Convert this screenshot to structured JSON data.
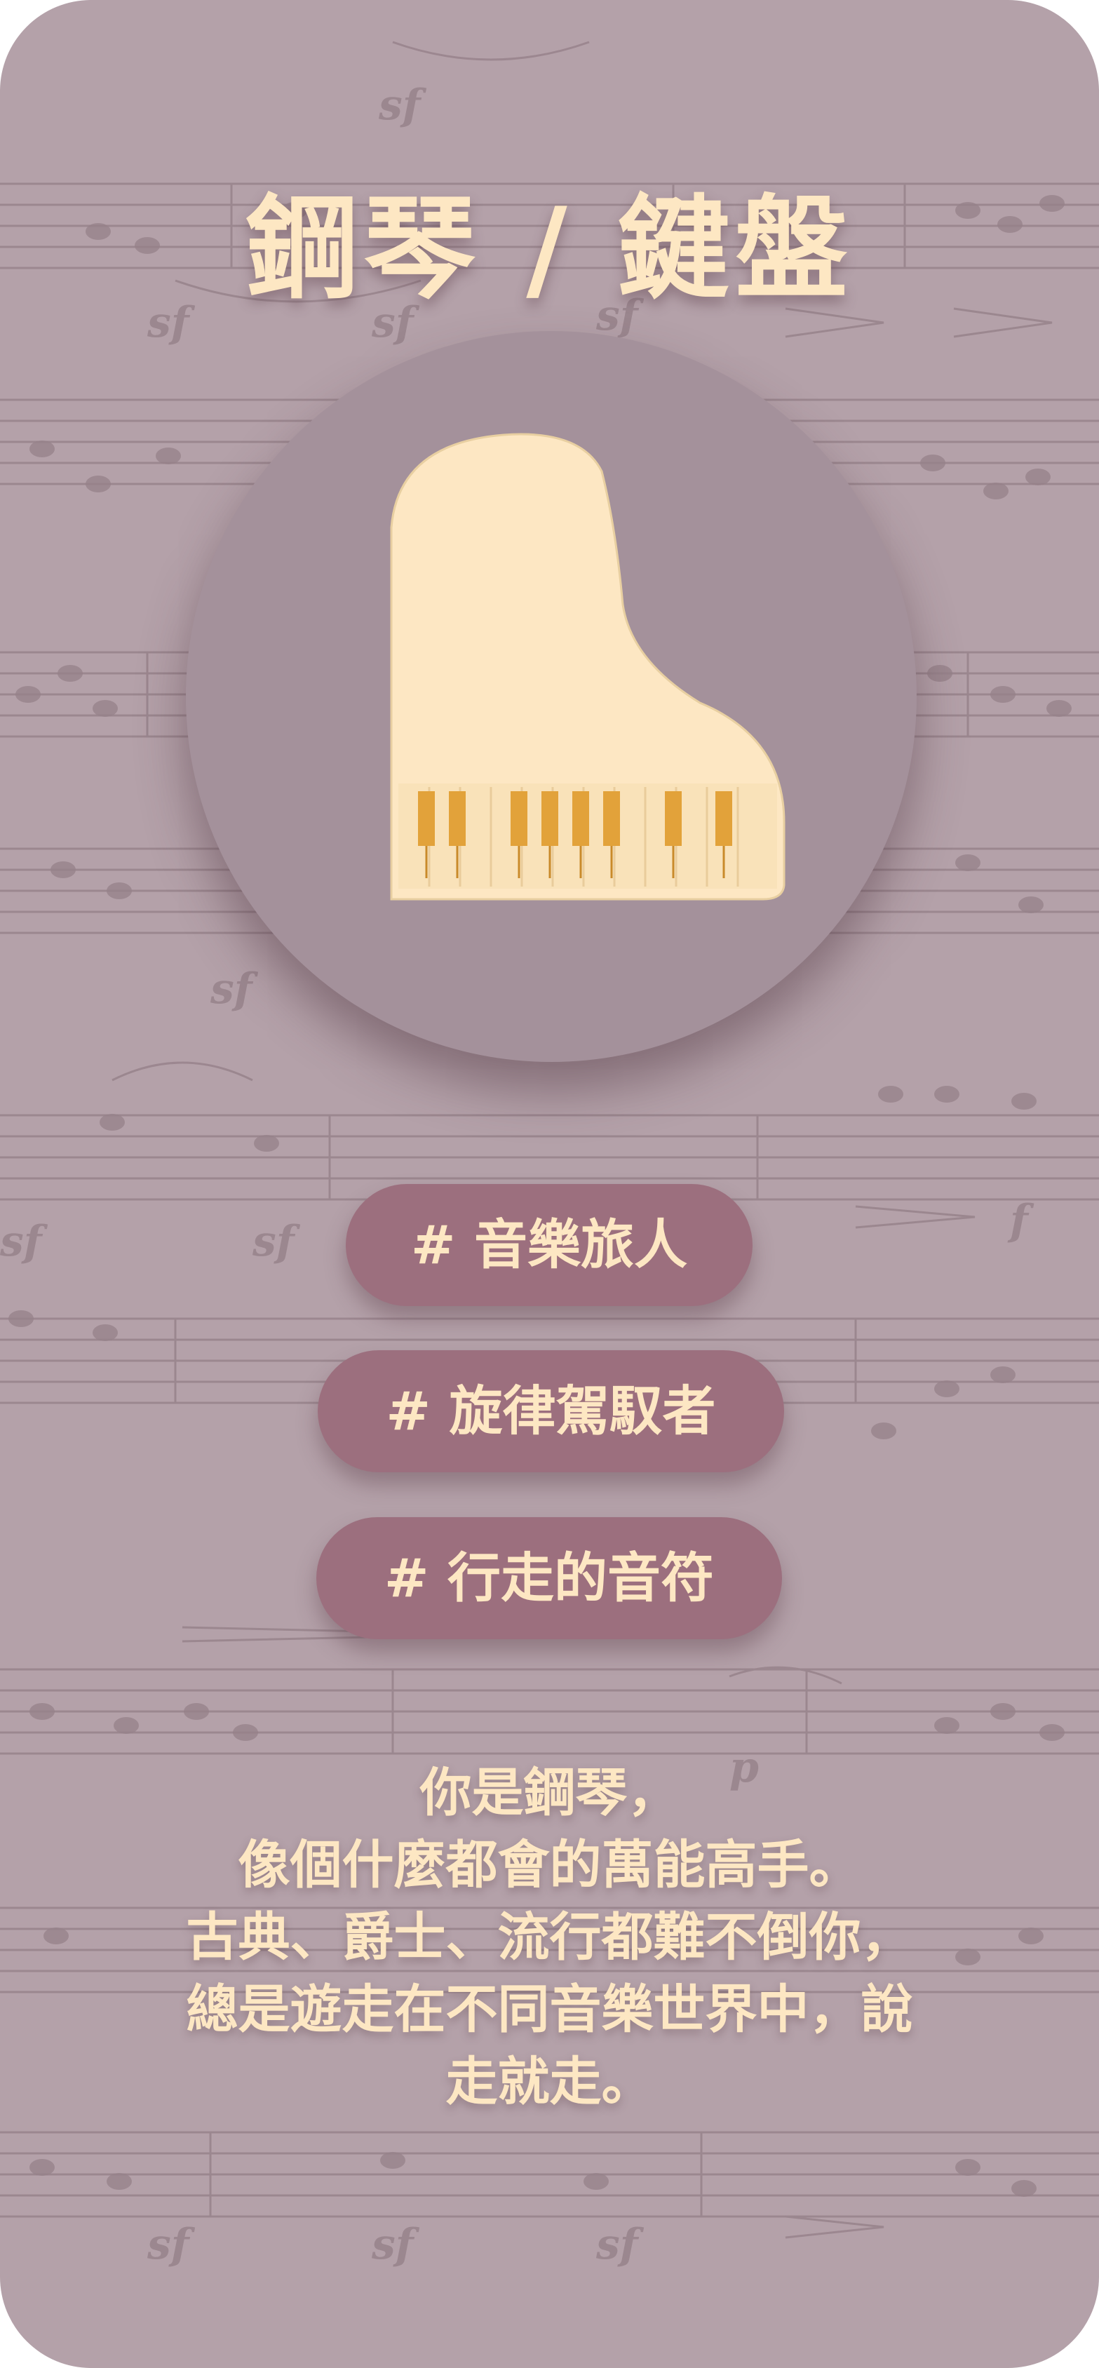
{
  "title": "鋼琴 / 鍵盤",
  "tags": [
    "# 音樂旅人",
    "# 旋律駕馭者",
    "# 行走的音符"
  ],
  "description": [
    "你是鋼琴，",
    "像個什麼都會的萬能高手。",
    "古典、爵士、流行都難不倒你，",
    "總是遊走在不同音樂世界中，說",
    "走就走。"
  ],
  "icons": {
    "main": "grand-piano-icon",
    "background": "sheet-music-background"
  },
  "colors": {
    "background": "#b4a1a9",
    "circle": "#a4919b",
    "accent_text": "#fde7c3",
    "tag_fill": "#9c6f7e",
    "piano_body": "#fde7c3",
    "piano_keys": "#e2a23a"
  }
}
